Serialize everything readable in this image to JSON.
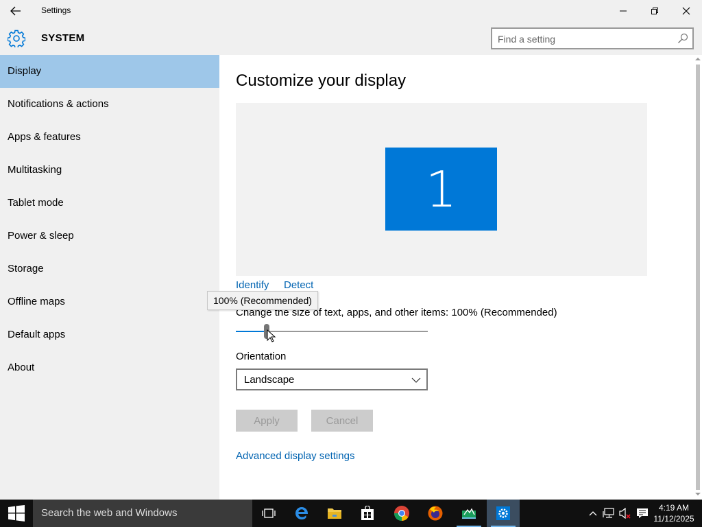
{
  "window": {
    "title": "Settings",
    "back_icon": "back-arrow-icon",
    "controls": [
      "minimize-icon",
      "maximize-icon",
      "close-icon"
    ]
  },
  "header": {
    "section_title": "SYSTEM",
    "section_icon": "gear-icon",
    "search": {
      "placeholder": "Find a setting",
      "value": ""
    }
  },
  "sidebar": {
    "items": [
      {
        "label": "Display",
        "active": true
      },
      {
        "label": "Notifications & actions"
      },
      {
        "label": "Apps & features"
      },
      {
        "label": "Multitasking"
      },
      {
        "label": "Tablet mode"
      },
      {
        "label": "Power & sleep"
      },
      {
        "label": "Storage"
      },
      {
        "label": "Offline maps"
      },
      {
        "label": "Default apps"
      },
      {
        "label": "About"
      }
    ]
  },
  "main": {
    "title": "Customize your display",
    "monitor_number": "1",
    "identify_label": "Identify",
    "detect_label": "Detect",
    "tooltip": "100% (Recommended)",
    "scale_label": "Change the size of text, apps, and other items: 100% (Recommended)",
    "scale_slider": {
      "value_fraction": 0.15
    },
    "orientation_label": "Orientation",
    "orientation_value": "Landscape",
    "apply_label": "Apply",
    "cancel_label": "Cancel",
    "advanced_link": "Advanced display settings"
  },
  "taskbar": {
    "search_text": "Search the web and Windows",
    "pinned": [
      "task-view-icon",
      "edge-icon",
      "file-explorer-icon",
      "store-icon",
      "chrome-icon",
      "firefox-icon",
      "app-icon",
      "settings-icon"
    ],
    "tray": [
      "chevron-up-icon",
      "network-icon",
      "volume-muted-icon",
      "action-center-icon"
    ],
    "time": "4:19 AM",
    "date": "11/12/2025"
  },
  "colors": {
    "accent": "#0078d7",
    "active_nav": "#9ec7e9",
    "link": "#0063b1",
    "panel_bg": "#f0f0f0",
    "taskbar_bg": "#101010"
  }
}
